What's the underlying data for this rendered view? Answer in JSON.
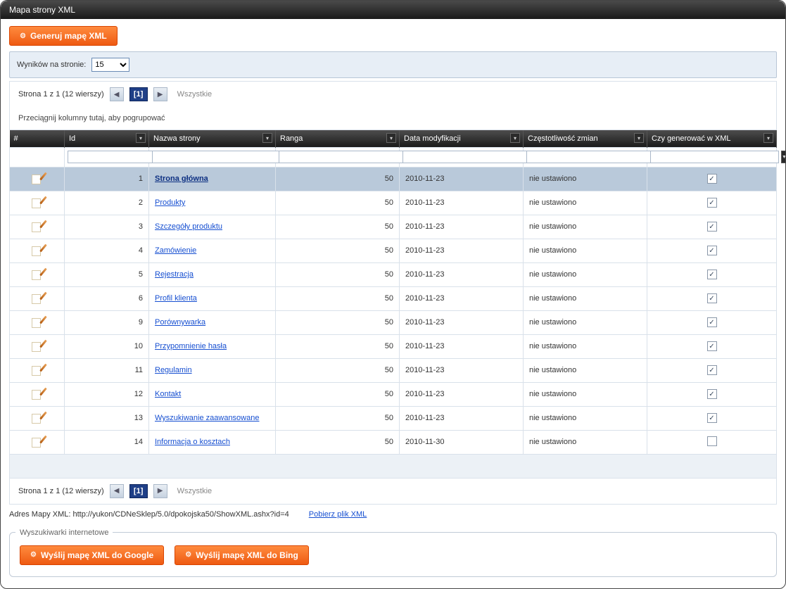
{
  "window": {
    "title": "Mapa strony XML"
  },
  "buttons": {
    "generate": "Generuj mapę XML",
    "send_google": "Wyślij mapę XML do Google",
    "send_bing": "Wyślij mapę XML do Bing"
  },
  "results_panel": {
    "label": "Wyników na stronie:",
    "value": "15"
  },
  "pager": {
    "summary": "Strona 1 z 1 (12 wierszy)",
    "current": "[1]",
    "all_label": "Wszystkie"
  },
  "group_hint": "Przeciągnij kolumny tutaj, aby pogrupować",
  "columns": {
    "hash": "#",
    "id": "Id",
    "name": "Nazwa strony",
    "rank": "Ranga",
    "modified": "Data modyfikacji",
    "frequency": "Częstotliwość zmian",
    "generate": "Czy generować w XML"
  },
  "rows": [
    {
      "id": "1",
      "name": "Strona główna",
      "rank": "50",
      "date": "2010-11-23",
      "freq": "nie ustawiono",
      "gen": true,
      "selected": true
    },
    {
      "id": "2",
      "name": "Produkty",
      "rank": "50",
      "date": "2010-11-23",
      "freq": "nie ustawiono",
      "gen": true,
      "selected": false
    },
    {
      "id": "3",
      "name": "Szczegóły produktu",
      "rank": "50",
      "date": "2010-11-23",
      "freq": "nie ustawiono",
      "gen": true,
      "selected": false
    },
    {
      "id": "4",
      "name": "Zamówienie",
      "rank": "50",
      "date": "2010-11-23",
      "freq": "nie ustawiono",
      "gen": true,
      "selected": false
    },
    {
      "id": "5",
      "name": "Rejestracja",
      "rank": "50",
      "date": "2010-11-23",
      "freq": "nie ustawiono",
      "gen": true,
      "selected": false
    },
    {
      "id": "6",
      "name": "Profil klienta",
      "rank": "50",
      "date": "2010-11-23",
      "freq": "nie ustawiono",
      "gen": true,
      "selected": false
    },
    {
      "id": "9",
      "name": "Porównywarka",
      "rank": "50",
      "date": "2010-11-23",
      "freq": "nie ustawiono",
      "gen": true,
      "selected": false
    },
    {
      "id": "10",
      "name": "Przypomnienie hasła",
      "rank": "50",
      "date": "2010-11-23",
      "freq": "nie ustawiono",
      "gen": true,
      "selected": false
    },
    {
      "id": "11",
      "name": "Regulamin",
      "rank": "50",
      "date": "2010-11-23",
      "freq": "nie ustawiono",
      "gen": true,
      "selected": false
    },
    {
      "id": "12",
      "name": "Kontakt",
      "rank": "50",
      "date": "2010-11-23",
      "freq": "nie ustawiono",
      "gen": true,
      "selected": false
    },
    {
      "id": "13",
      "name": "Wyszukiwanie zaawansowane",
      "rank": "50",
      "date": "2010-11-23",
      "freq": "nie ustawiono",
      "gen": true,
      "selected": false
    },
    {
      "id": "14",
      "name": "Informacja o kosztach",
      "rank": "50",
      "date": "2010-11-30",
      "freq": "nie ustawiono",
      "gen": false,
      "selected": false
    }
  ],
  "address": {
    "label": "Adres Mapy XML: http://yukon/CDNeSklep/5.0/dpokojska50/ShowXML.ashx?id=4",
    "download": "Pobierz plik XML"
  },
  "engines_legend": "Wyszukiwarki internetowe"
}
